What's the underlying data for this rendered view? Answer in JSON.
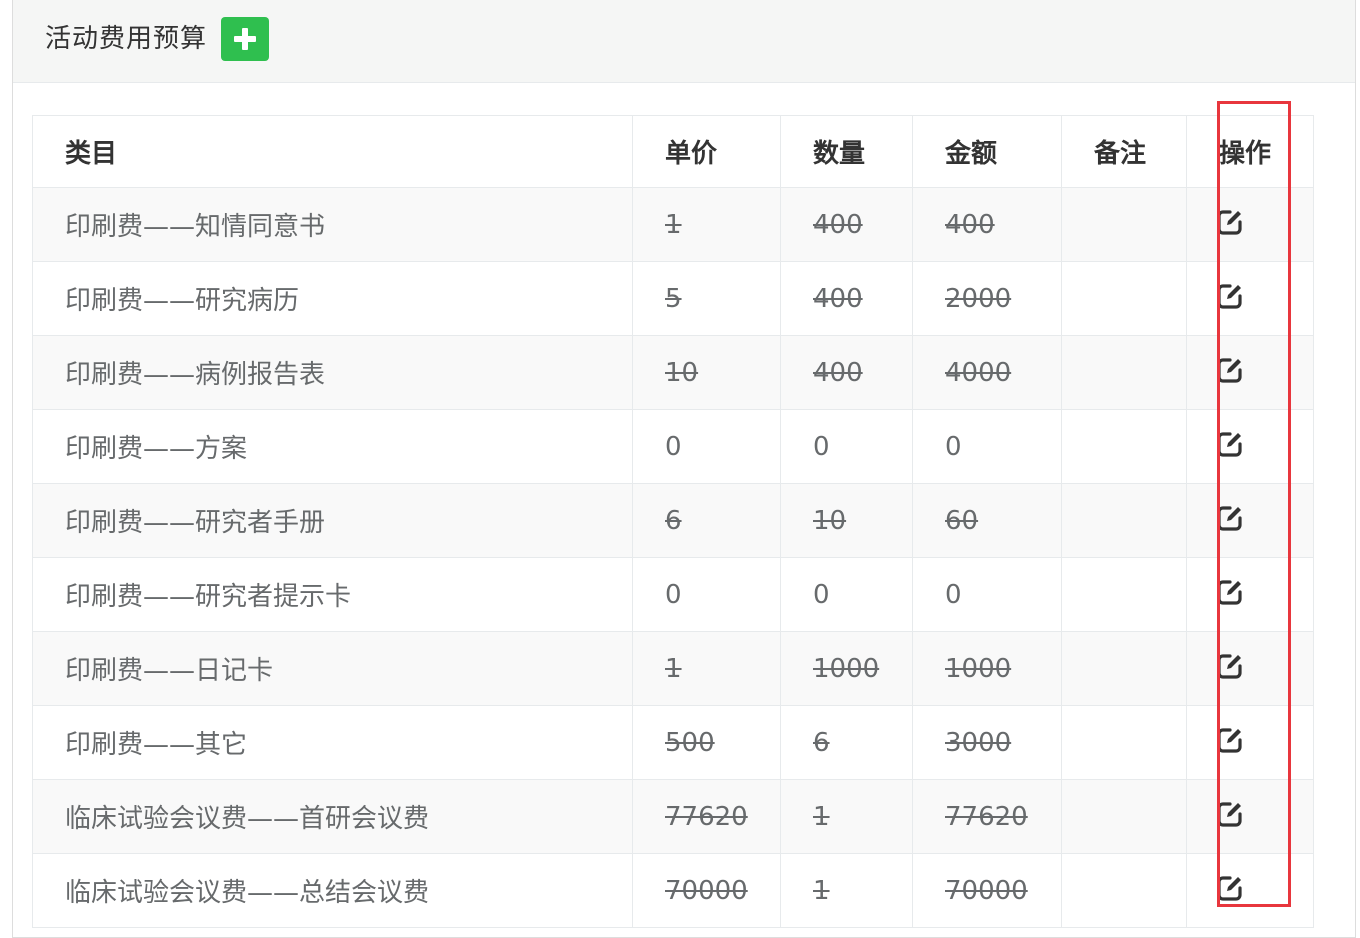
{
  "panel": {
    "title": "活动费用预算",
    "add_button_icon": "plus-icon",
    "add_button_color": "#2fbf4f"
  },
  "table": {
    "headers": {
      "category": "类目",
      "unit_price": "单价",
      "quantity": "数量",
      "amount": "金额",
      "remark": "备注",
      "action": "操作"
    },
    "rows": [
      {
        "category": "印刷费——知情同意书",
        "unit_price": "1",
        "quantity": "400",
        "amount": "400",
        "remark": "",
        "strike": true
      },
      {
        "category": "印刷费——研究病历",
        "unit_price": "5",
        "quantity": "400",
        "amount": "2000",
        "remark": "",
        "strike": true
      },
      {
        "category": "印刷费——病例报告表",
        "unit_price": "10",
        "quantity": "400",
        "amount": "4000",
        "remark": "",
        "strike": true
      },
      {
        "category": "印刷费——方案",
        "unit_price": "0",
        "quantity": "0",
        "amount": "0",
        "remark": "",
        "strike": false
      },
      {
        "category": "印刷费——研究者手册",
        "unit_price": "6",
        "quantity": "10",
        "amount": "60",
        "remark": "",
        "strike": true
      },
      {
        "category": "印刷费——研究者提示卡",
        "unit_price": "0",
        "quantity": "0",
        "amount": "0",
        "remark": "",
        "strike": false
      },
      {
        "category": "印刷费——日记卡",
        "unit_price": "1",
        "quantity": "1000",
        "amount": "1000",
        "remark": "",
        "strike": true
      },
      {
        "category": "印刷费——其它",
        "unit_price": "500",
        "quantity": "6",
        "amount": "3000",
        "remark": "",
        "strike": true
      },
      {
        "category": "临床试验会议费——首研会议费",
        "unit_price": "77620",
        "quantity": "1",
        "amount": "77620",
        "remark": "",
        "strike": true
      },
      {
        "category": "临床试验会议费——总结会议费",
        "unit_price": "70000",
        "quantity": "1",
        "amount": "70000",
        "remark": "",
        "strike": true
      }
    ],
    "action_icon": "edit-icon"
  },
  "highlight_color": "#e8363d"
}
